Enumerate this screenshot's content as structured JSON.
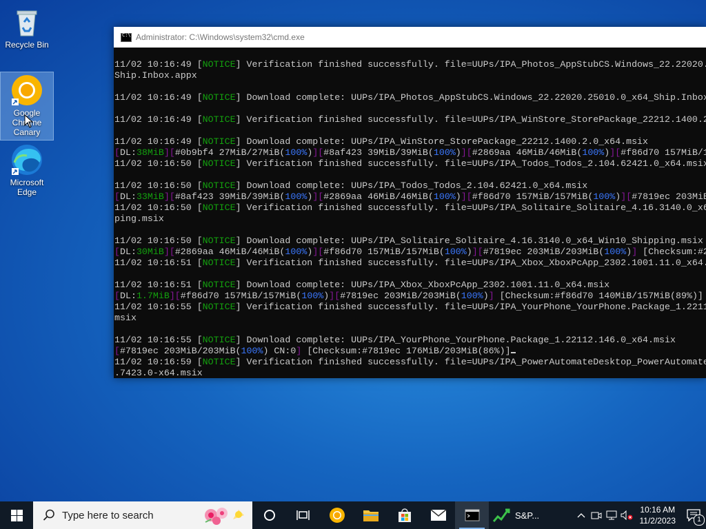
{
  "desktop": {
    "icons": [
      {
        "label": "Recycle Bin"
      },
      {
        "label": "Google Chrome Canary"
      },
      {
        "label": "Microsoft Edge"
      }
    ]
  },
  "cmd": {
    "title": "Administrator: C:\\Windows\\system32\\cmd.exe"
  },
  "taskbar": {
    "search_placeholder": "Type here to search",
    "stock_label": "S&P...",
    "clock_time": "10:16 AM",
    "clock_date": "11/2/2023",
    "notification_count": "1"
  },
  "colors": {
    "notice": "#13a10e",
    "bracket": "#881798",
    "percent": "#3b78ff"
  }
}
